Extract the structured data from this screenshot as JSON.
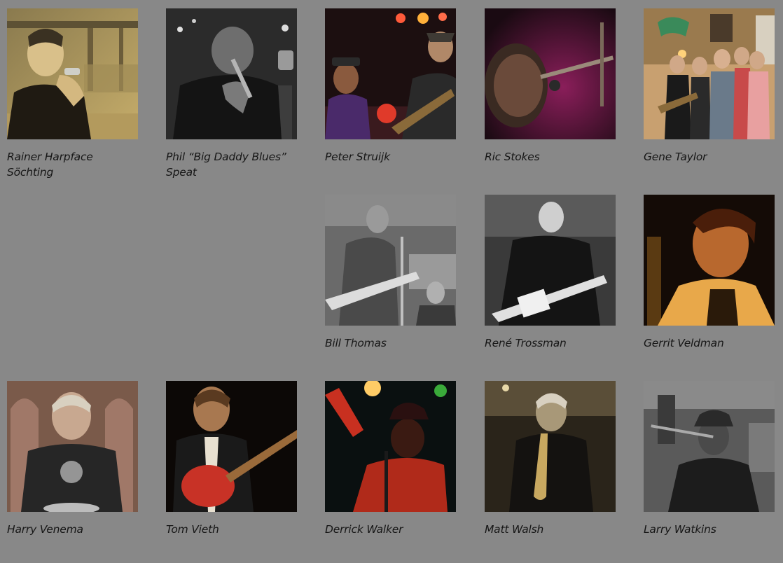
{
  "musicians": [
    {
      "name": "Rainer Harpface Söchting",
      "photo": "photo-harmonica-player"
    },
    {
      "name": "Phil “Big Daddy Blues” Speat",
      "photo": "photo-singer-microphone"
    },
    {
      "name": "Peter Struijk",
      "photo": "photo-guitarists-stage"
    },
    {
      "name": "Ric Stokes",
      "photo": "photo-singer-closeup"
    },
    {
      "name": "Gene Taylor",
      "photo": "photo-band-group"
    },
    {
      "name": "Bill Thomas",
      "photo": "photo-guitarist-club"
    },
    {
      "name": "René Trossman",
      "photo": "photo-guitarist-bw"
    },
    {
      "name": "Gerrit Veldman",
      "photo": "photo-singer-warm"
    },
    {
      "name": "Harry Venema",
      "photo": "photo-drummer-smiling"
    },
    {
      "name": "Tom Vieth",
      "photo": "photo-guitarist-red-guitar"
    },
    {
      "name": "Derrick Walker",
      "photo": "photo-singer-red-light"
    },
    {
      "name": "Matt Walsh",
      "photo": "photo-saxophonist"
    },
    {
      "name": "Larry Watkins",
      "photo": "photo-singer-hat"
    }
  ]
}
